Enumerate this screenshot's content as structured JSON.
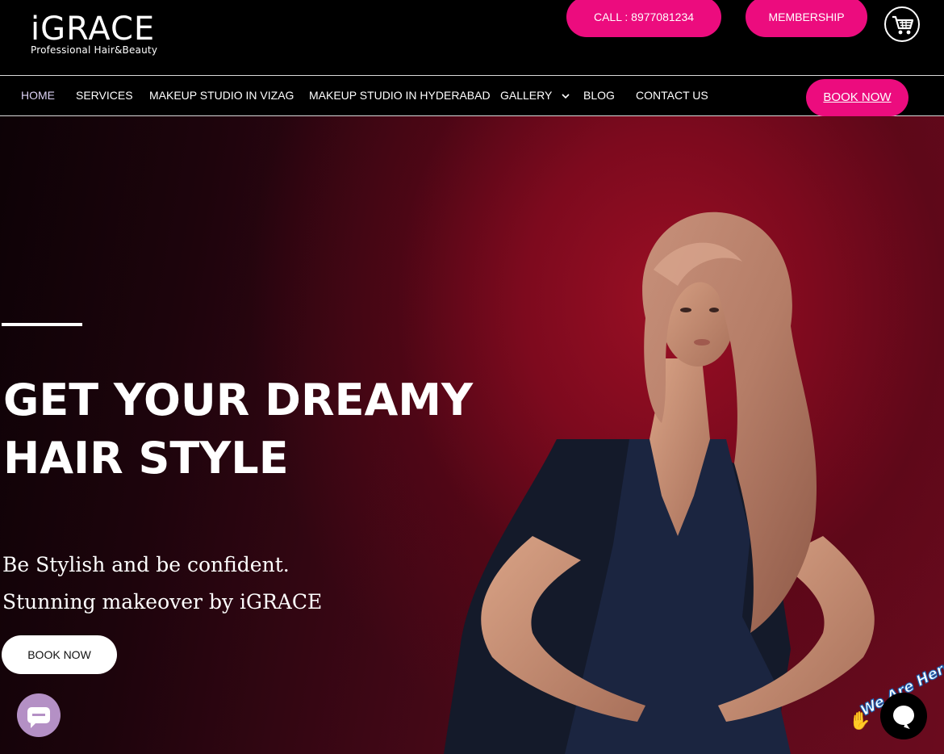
{
  "header": {
    "logo_main": "iGRACE",
    "logo_sub": "Professional Hair&Beauty",
    "call_label": "CALL : 8977081234",
    "membership_label": "MEMBERSHIP",
    "cart_icon": "cart-icon"
  },
  "nav": {
    "items": [
      {
        "label": "HOME"
      },
      {
        "label": "SERVICES"
      },
      {
        "label": "MAKEUP STUDIO IN VIZAG"
      },
      {
        "label": "MAKEUP STUDIO IN HYDERABAD"
      },
      {
        "label": "GALLERY"
      },
      {
        "label": "BLOG"
      },
      {
        "label": "CONTACT US"
      }
    ],
    "book_now": "BOOK NOW"
  },
  "hero": {
    "title_line1": "GET YOUR DREAMY",
    "title_line2": "HAIR STYLE",
    "sub_line1": "Be Stylish and be confident.",
    "sub_line2": "Stunning makeover by iGRACE",
    "cta": "BOOK NOW"
  },
  "widgets": {
    "we_are_here": "We Are Here!"
  },
  "colors": {
    "accent": "#ec0c7e",
    "hero_red": "#7d0a1e",
    "nav_active": "#dcd2f5"
  }
}
